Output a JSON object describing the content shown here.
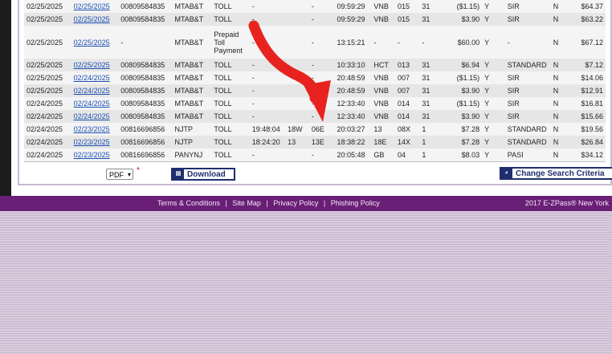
{
  "transactions": [
    [
      "02/25/2025",
      "02/25/2025",
      "00809584835",
      "MTAB&T",
      "TOLL",
      "-",
      "",
      "-",
      "09:59:29",
      "VNB",
      "015",
      "31",
      "($1.15)",
      "Y",
      "SIR",
      "N",
      "$64.37"
    ],
    [
      "02/25/2025",
      "02/25/2025",
      "00809584835",
      "MTAB&T",
      "TOLL",
      "-",
      "",
      "-",
      "09:59:29",
      "VNB",
      "015",
      "31",
      "$3.90",
      "Y",
      "SIR",
      "N",
      "$63.22"
    ],
    [
      "02/25/2025",
      "02/25/2025",
      "-",
      "MTAB&T",
      "Prepaid Toll Payment",
      "-",
      "",
      "-",
      "13:15:21",
      "-",
      "-",
      "-",
      "$60.00",
      "Y",
      "-",
      "N",
      "$67.12"
    ],
    [
      "02/25/2025",
      "02/25/2025",
      "00809584835",
      "MTAB&T",
      "TOLL",
      "-",
      "",
      "-",
      "10:33:10",
      "HCT",
      "013",
      "31",
      "$6.94",
      "Y",
      "STANDARD",
      "N",
      "$7.12"
    ],
    [
      "02/25/2025",
      "02/24/2025",
      "00809584835",
      "MTAB&T",
      "TOLL",
      "-",
      "",
      "-",
      "20:48:59",
      "VNB",
      "007",
      "31",
      "($1.15)",
      "Y",
      "SIR",
      "N",
      "$14.06"
    ],
    [
      "02/25/2025",
      "02/24/2025",
      "00809584835",
      "MTAB&T",
      "TOLL",
      "-",
      "",
      "-",
      "20:48:59",
      "VNB",
      "007",
      "31",
      "$3.90",
      "Y",
      "SIR",
      "N",
      "$12.91"
    ],
    [
      "02/24/2025",
      "02/24/2025",
      "00809584835",
      "MTAB&T",
      "TOLL",
      "-",
      "",
      "-",
      "12:33:40",
      "VNB",
      "014",
      "31",
      "($1.15)",
      "Y",
      "SIR",
      "N",
      "$16.81"
    ],
    [
      "02/24/2025",
      "02/24/2025",
      "00809584835",
      "MTAB&T",
      "TOLL",
      "-",
      "",
      "-",
      "12:33:40",
      "VNB",
      "014",
      "31",
      "$3.90",
      "Y",
      "SIR",
      "N",
      "$15.66"
    ],
    [
      "02/24/2025",
      "02/23/2025",
      "00816696856",
      "NJTP",
      "TOLL",
      "19:48:04",
      "18W",
      "06E",
      "20:03:27",
      "13",
      "08X",
      "1",
      "$7.28",
      "Y",
      "STANDARD",
      "N",
      "$19.56"
    ],
    [
      "02/24/2025",
      "02/23/2025",
      "00816696856",
      "NJTP",
      "TOLL",
      "18:24:20",
      "13",
      "13E",
      "18:38:22",
      "18E",
      "14X",
      "1",
      "$7.28",
      "Y",
      "STANDARD",
      "N",
      "$26.84"
    ],
    [
      "02/24/2025",
      "02/23/2025",
      "00816696856",
      "PANYNJ",
      "TOLL",
      "-",
      "",
      "-",
      "20:05:48",
      "GB",
      "04",
      "1",
      "$8.03",
      "Y",
      "PASI",
      "N",
      "$34.12"
    ]
  ],
  "toolbar": {
    "format_value": "PDF",
    "required_mark": "*",
    "download_label": "Download",
    "change_search_label": "Change Search Criteria"
  },
  "footer": {
    "terms": "Terms & Conditions",
    "sitemap": "Site Map",
    "privacy": "Privacy Policy",
    "phishing": "Phishing Policy",
    "separator": "|",
    "copyright": "2017 E-ZPass® New York"
  },
  "colors": {
    "footer_bg": "#6a1f77",
    "link": "#1a4fb4",
    "button_border": "#1f2e6e",
    "annotation_arrow": "#e8231f"
  },
  "icons": {
    "download_button_icon": "download-icon",
    "change_search_icon": "search-icon",
    "select_chevron": "chevron-down-icon",
    "annotation": "red-arrow-icon"
  }
}
